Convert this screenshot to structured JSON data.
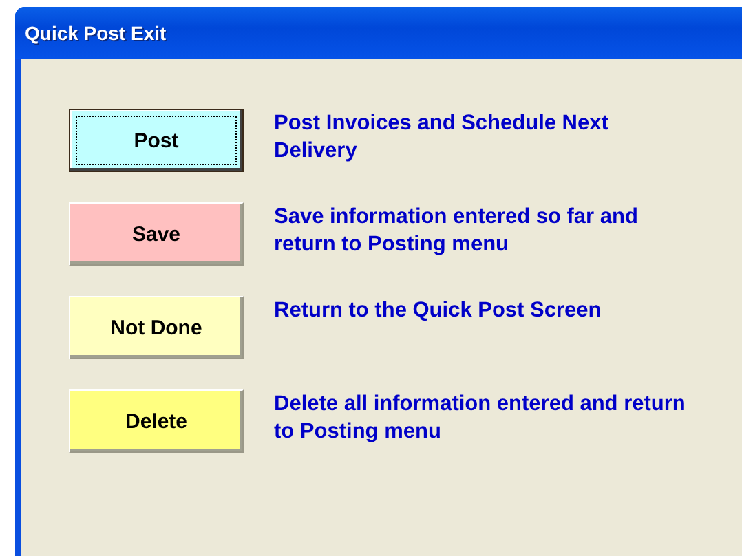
{
  "window": {
    "title": "Quick Post Exit"
  },
  "options": [
    {
      "label": "Post",
      "color": "#c0ffff",
      "focused": true,
      "description": "Post Invoices and Schedule Next Delivery"
    },
    {
      "label": "Save",
      "color": "#ffc0c0",
      "focused": false,
      "description": "Save information entered so far and return to Posting menu"
    },
    {
      "label": "Not Done",
      "color": "#ffffc0",
      "focused": false,
      "description": "Return to the Quick Post Screen"
    },
    {
      "label": "Delete",
      "color": "#ffff80",
      "focused": false,
      "description": "Delete all information entered and return to Posting menu"
    }
  ]
}
